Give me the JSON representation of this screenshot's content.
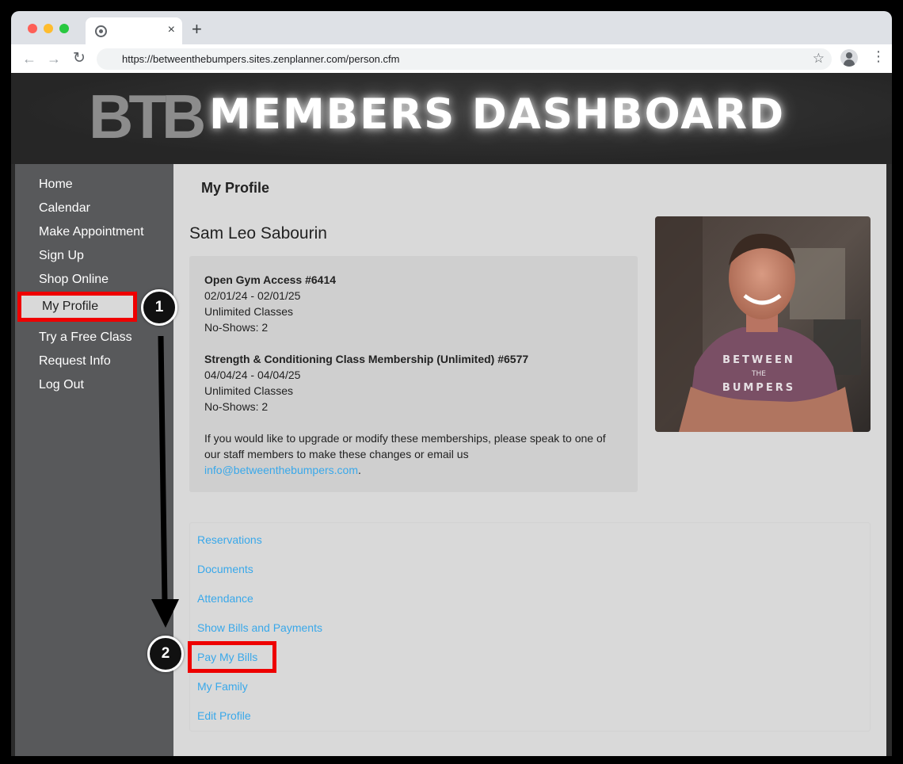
{
  "browser": {
    "tab_close": "×",
    "new_tab": "+",
    "url": "https://betweenthebumpers.sites.zenplanner.com/person.cfm",
    "back_glyph": "←",
    "forward_glyph": "→",
    "reload_glyph": "↻",
    "star_glyph": "☆",
    "menu_glyph": "⋮"
  },
  "banner": {
    "logo_text": "BTB",
    "title": "MEMBERS DASHBOARD"
  },
  "sidebar": {
    "items": [
      {
        "label": "Home"
      },
      {
        "label": "Calendar"
      },
      {
        "label": "Make Appointment"
      },
      {
        "label": "Sign Up"
      },
      {
        "label": "Shop Online"
      },
      {
        "label": "My Profile",
        "active": true
      },
      {
        "label": "Try a Free Class"
      },
      {
        "label": "Request Info"
      },
      {
        "label": "Log Out"
      }
    ]
  },
  "profile": {
    "page_title": "My Profile",
    "name": "Sam Leo Sabourin",
    "memberships": [
      {
        "title": "Open Gym Access #6414",
        "dates": "02/01/24 - 02/01/25",
        "classes": "Unlimited Classes",
        "no_shows": "No-Shows: 2"
      },
      {
        "title": "Strength & Conditioning Class Membership (Unlimited) #6577",
        "dates": "04/04/24 - 04/04/25",
        "classes": "Unlimited Classes",
        "no_shows": "No-Shows: 2"
      }
    ],
    "notice_text": "If you would like to upgrade or modify these memberships, please speak to one of our staff members to make these changes or email us ",
    "email": "info@betweenthebumpers.com",
    "notice_end": ".",
    "shirt_line1": "BETWEEN",
    "shirt_line2": "THE",
    "shirt_line3": "BUMPERS"
  },
  "links": [
    {
      "label": "Reservations"
    },
    {
      "label": "Documents"
    },
    {
      "label": "Attendance"
    },
    {
      "label": "Show Bills and Payments"
    },
    {
      "label": "Pay My Bills"
    },
    {
      "label": "My Family"
    },
    {
      "label": "Edit Profile"
    }
  ],
  "callouts": {
    "step1": "1",
    "step2": "2"
  },
  "colors": {
    "link": "#39a8ea",
    "highlight": "#ee0000",
    "sidebar": "#58595b",
    "content": "#d9d9d9"
  }
}
